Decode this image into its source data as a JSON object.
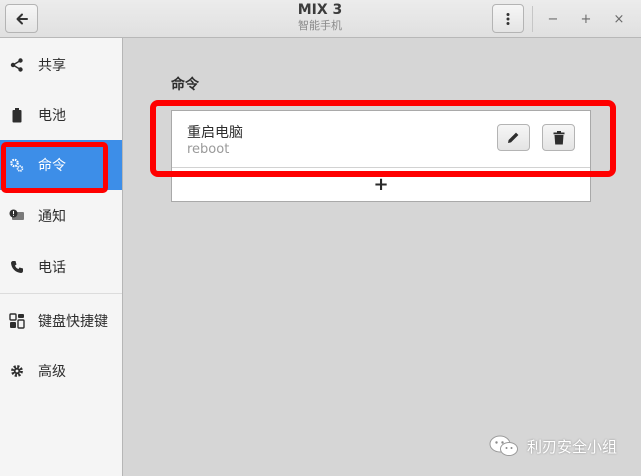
{
  "window": {
    "title": "MIX 3",
    "subtitle": "智能手机"
  },
  "header": {
    "back_icon": "arrow-left-icon",
    "menu_icon": "vertical-ellipsis-icon",
    "minimize_glyph": "−",
    "maximize_glyph": "+",
    "close_glyph": "×"
  },
  "sidebar": {
    "items": [
      {
        "label": "共享",
        "icon": "share-icon"
      },
      {
        "label": "电池",
        "icon": "battery-icon"
      },
      {
        "label": "命令",
        "icon": "gears-icon",
        "active": true
      },
      {
        "label": "通知",
        "icon": "notification-icon"
      },
      {
        "label": "电话",
        "icon": "phone-icon"
      },
      {
        "label": "键盘快捷键",
        "icon": "keyboard-shortcuts-icon"
      },
      {
        "label": "高级",
        "icon": "gear-icon"
      }
    ]
  },
  "main": {
    "section_title": "命令",
    "commands": [
      {
        "name": "重启电脑",
        "command": "reboot",
        "edit_icon": "pencil-icon",
        "delete_icon": "trash-icon"
      }
    ],
    "add_label": "+"
  },
  "watermark": {
    "text": "利刃安全小组",
    "icon": "wechat-icon"
  },
  "colors": {
    "accent": "#3d8ee8",
    "highlight_box": "#ff0000",
    "background": "#d6d6d6",
    "sidebar_bg": "#f5f5f5"
  }
}
